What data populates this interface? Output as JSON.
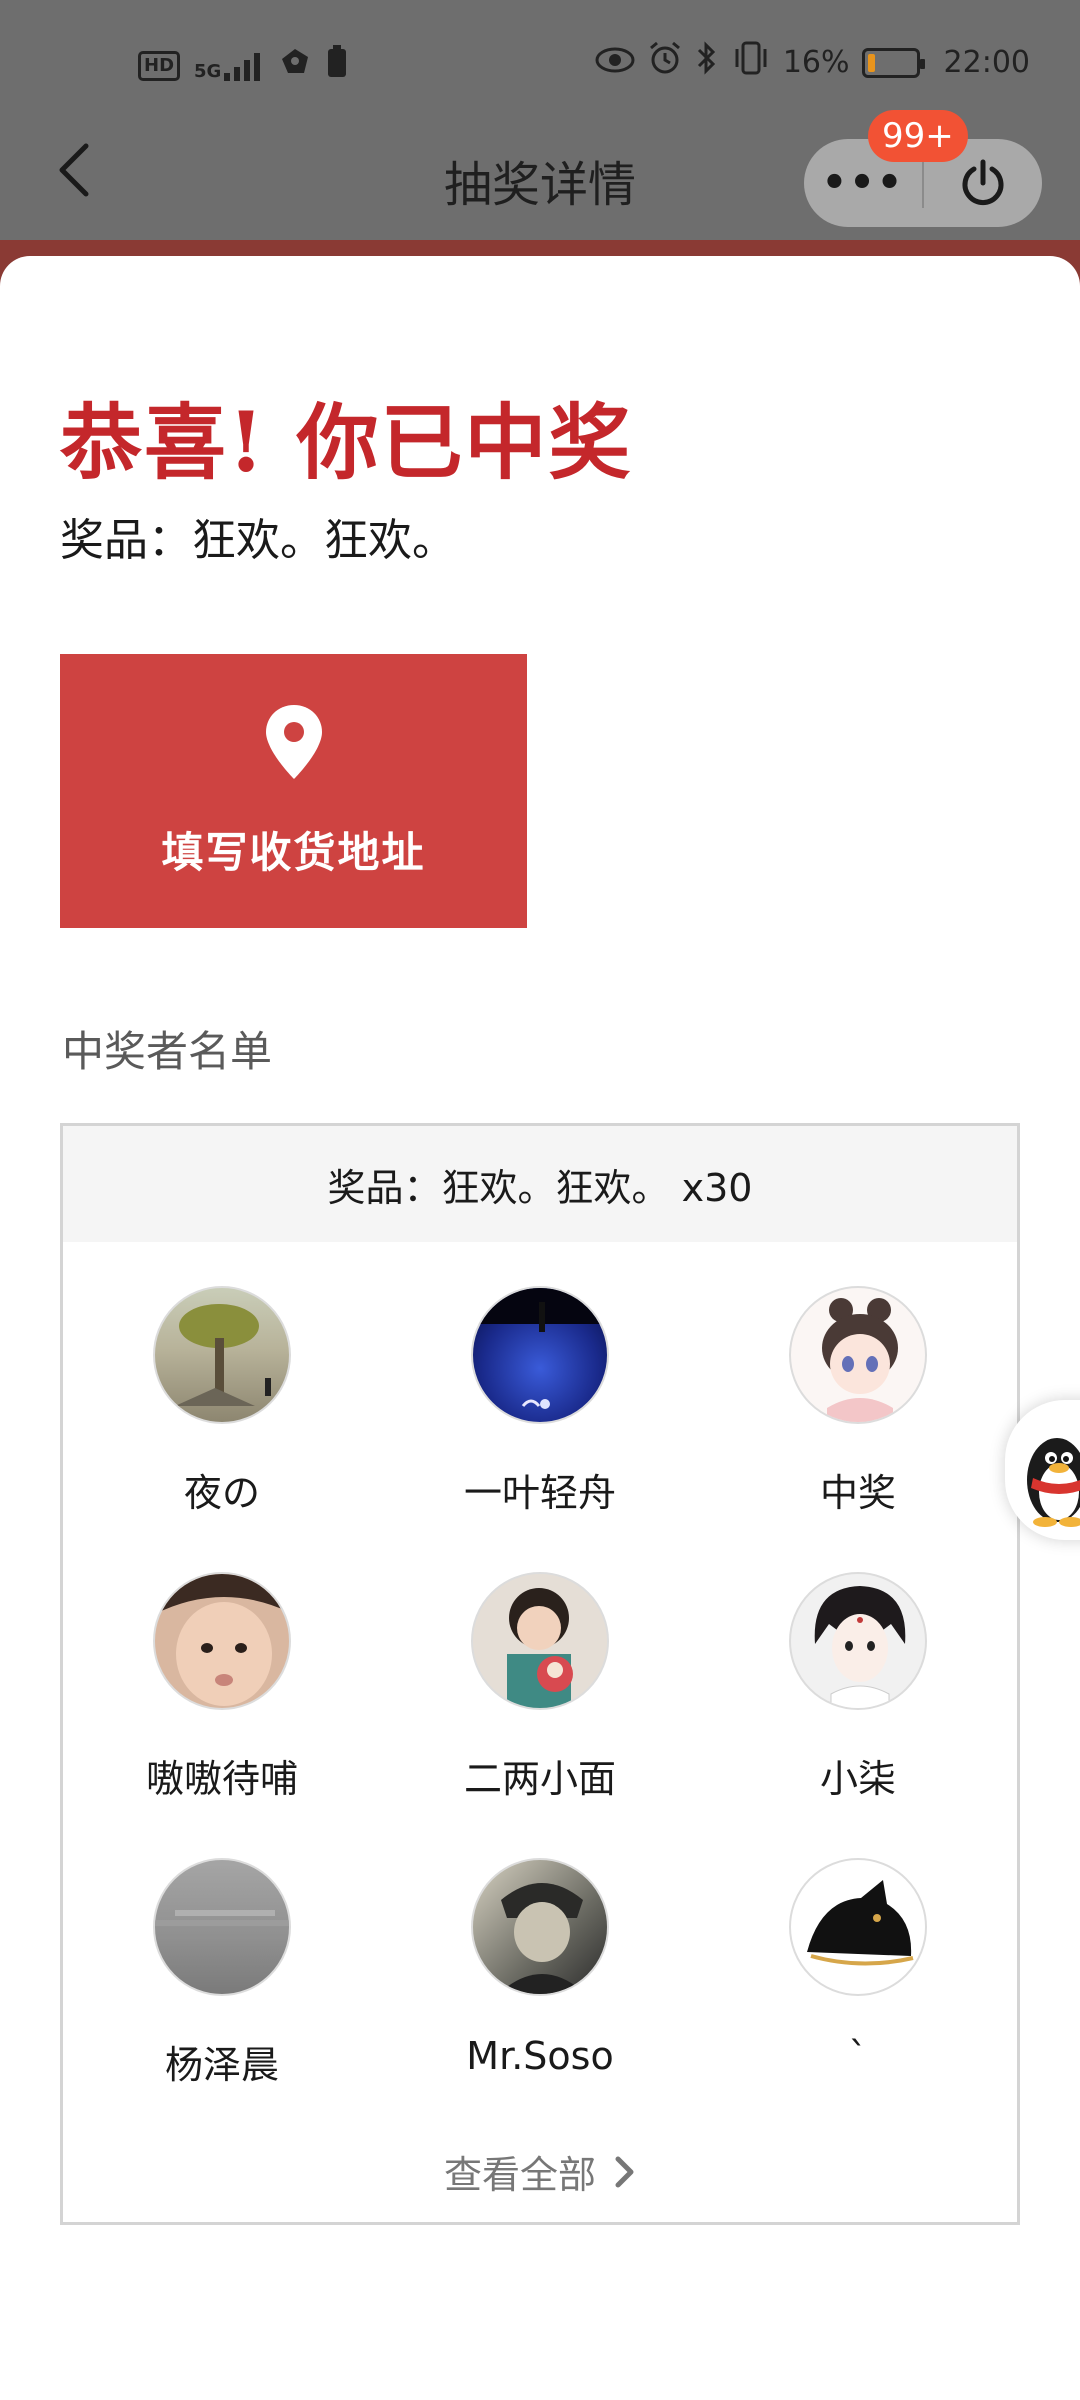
{
  "status_bar": {
    "left_icons": [
      "hd-icon",
      "5g-signal-icon",
      "app-notification-icon",
      "battery-saver-icon"
    ],
    "network_label": "5G",
    "hd_label": "HD",
    "right_icons": [
      "eye-icon",
      "alarm-icon",
      "bluetooth-icon",
      "vibrate-icon"
    ],
    "battery_percent": "16%",
    "battery_level": 0.16,
    "time": "22:00"
  },
  "nav": {
    "title": "抽奖详情",
    "more_label": "•••",
    "badge": "99+"
  },
  "result": {
    "headline": "恭喜! 你已中奖",
    "prize_line": "奖品：狂欢。狂欢。"
  },
  "address_button": {
    "label": "填写收货地址",
    "icon": "location-pin-icon"
  },
  "winners": {
    "title": "中奖者名单",
    "box_header": "奖品：狂欢。狂欢。 x30",
    "items": [
      {
        "name": "夜の"
      },
      {
        "name": "一叶轻舟"
      },
      {
        "name": "中奖"
      },
      {
        "name": "嗷嗷待哺"
      },
      {
        "name": "二两小面"
      },
      {
        "name": "小柒"
      },
      {
        "name": "杨泽晨"
      },
      {
        "name": "Mr.Soso"
      },
      {
        "name": "`"
      }
    ],
    "view_all": "查看全部"
  },
  "colors": {
    "accent": "#c4272b",
    "button": "#ce4341",
    "badge": "#f25234"
  }
}
